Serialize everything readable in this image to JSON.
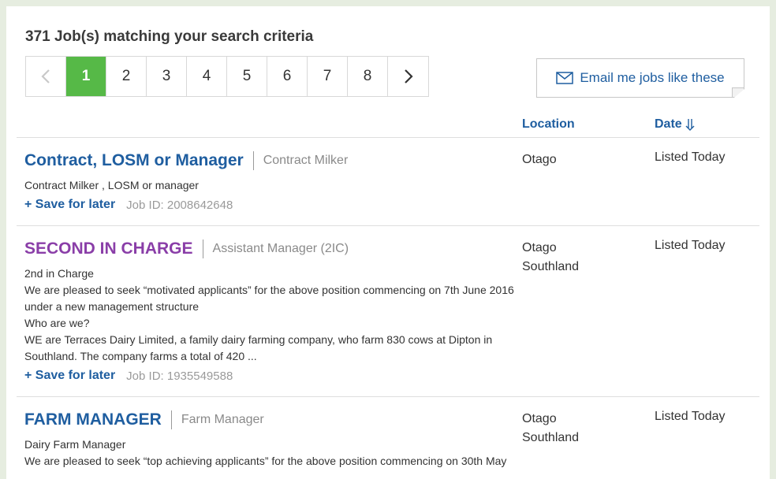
{
  "results": {
    "count_text": "371 Job(s) matching your search criteria"
  },
  "pagination": {
    "prev_icon": "chevron-left-icon",
    "next_icon": "chevron-right-icon",
    "pages": [
      "1",
      "2",
      "3",
      "4",
      "5",
      "6",
      "7",
      "8"
    ],
    "active_page": "1"
  },
  "email_button": {
    "label": "Email me jobs like these",
    "icon": "envelope-icon"
  },
  "columns": {
    "location": "Location",
    "date": "Date",
    "sort_icon": "arrow-down-icon"
  },
  "jobs": [
    {
      "title": "Contract, LOSM or Manager",
      "category": "Contract Milker",
      "description": [
        "Contract Milker , LOSM or manager"
      ],
      "save_label": "+ Save for later",
      "job_id": "Job ID: 2008642648",
      "locations": [
        "Otago"
      ],
      "date": "Listed Today"
    },
    {
      "title": "SECOND IN CHARGE",
      "category": "Assistant Manager (2IC)",
      "description": [
        "2nd in Charge",
        "We are pleased to seek “motivated applicants” for the above position commencing on 7th June 2016",
        "under a new management structure",
        "Who are we?",
        "WE are Terraces Dairy Limited, a family dairy farming company, who farm 830 cows at Dipton in",
        "Southland. The company farms a total of 420 ..."
      ],
      "save_label": "+ Save for later",
      "job_id": "Job ID: 1935549588",
      "locations": [
        "Otago",
        "Southland"
      ],
      "date": "Listed Today"
    },
    {
      "title": "FARM MANAGER",
      "category": "Farm Manager",
      "description": [
        "Dairy Farm Manager",
        "We are pleased to seek “top achieving applicants” for the above position commencing on 30th May"
      ],
      "locations": [
        "Otago",
        "Southland"
      ],
      "date": "Listed Today"
    }
  ],
  "colors": {
    "link_blue": "#1f5ea0",
    "featured_purple": "#8a3ea8",
    "active_page_green": "#56b947",
    "page_background": "#e6ede0"
  }
}
